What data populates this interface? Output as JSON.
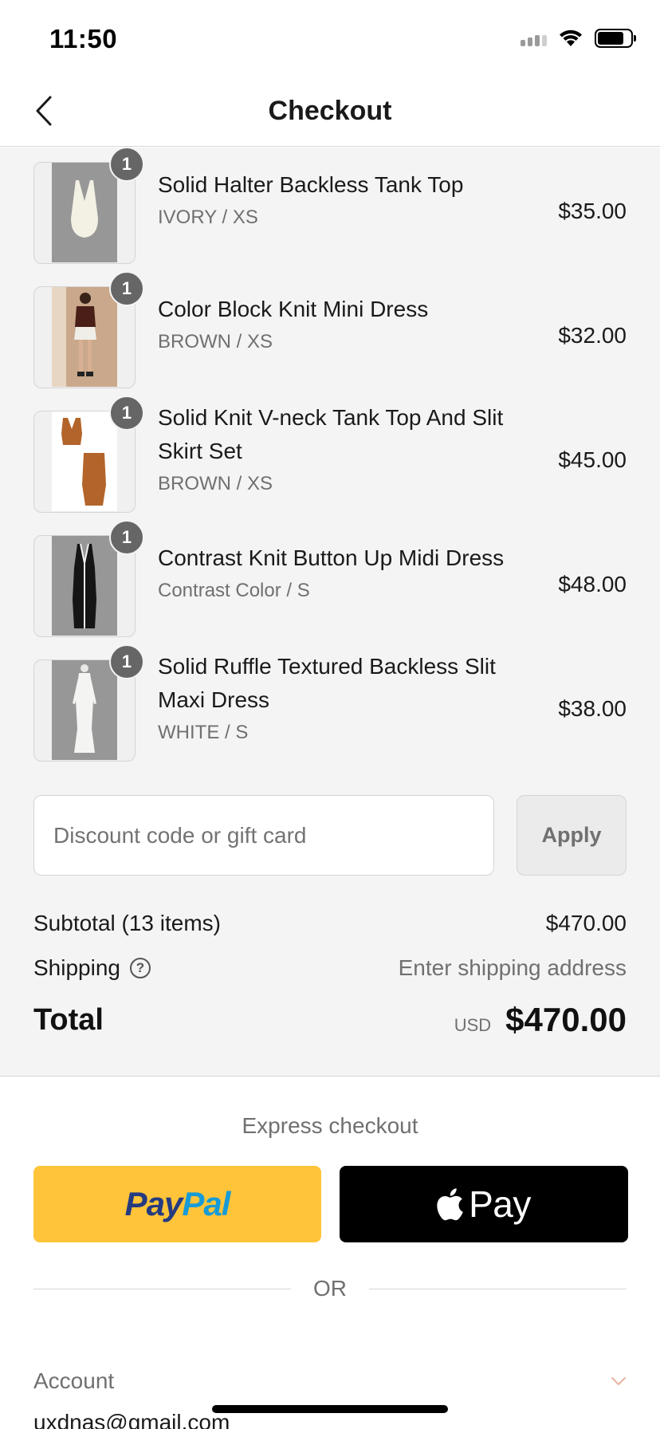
{
  "status_bar": {
    "time": "11:50"
  },
  "header": {
    "title": "Checkout",
    "back_icon": "chevron-left-icon"
  },
  "items": [
    {
      "name": "Solid Halter Backless Tank Top",
      "variant": "IVORY / XS",
      "price": "$35.00",
      "quantity": "1",
      "thumb_color": "#f3f0e4"
    },
    {
      "name": "Color Block Knit Mini Dress",
      "variant": "BROWN / XS",
      "price": "$32.00",
      "quantity": "1",
      "thumb_color": "#4a1f18"
    },
    {
      "name": "Solid Knit V-neck Tank Top And Slit Skirt Set",
      "variant": "BROWN / XS",
      "price": "$45.00",
      "quantity": "1",
      "thumb_color": "#b3642a"
    },
    {
      "name": "Contrast Knit Button Up Midi Dress",
      "variant": "Contrast Color / S",
      "price": "$48.00",
      "quantity": "1",
      "thumb_color": "#151515"
    },
    {
      "name": "Solid Ruffle Textured Backless Slit Maxi Dress",
      "variant": "WHITE / S",
      "price": "$38.00",
      "quantity": "1",
      "thumb_color": "#f4f4f2"
    }
  ],
  "discount": {
    "placeholder": "Discount code or gift card",
    "apply_label": "Apply"
  },
  "summary": {
    "subtotal_label": "Subtotal (13 items)",
    "subtotal_value": "$470.00",
    "shipping_label": "Shipping",
    "shipping_value": "Enter shipping address",
    "total_label": "Total",
    "currency": "USD",
    "total_value": "$470.00"
  },
  "express": {
    "label": "Express checkout",
    "paypal_pay": "Pay",
    "paypal_pal": "Pal",
    "applepay_label": "Pay"
  },
  "or_label": "OR",
  "account": {
    "label": "Account",
    "email": "uxdnas@gmail.com"
  },
  "colors": {
    "paypal": "#ffc439",
    "applepay": "#000000",
    "background": "#f4f4f4",
    "chevron_accent": "#e8b4a0"
  }
}
